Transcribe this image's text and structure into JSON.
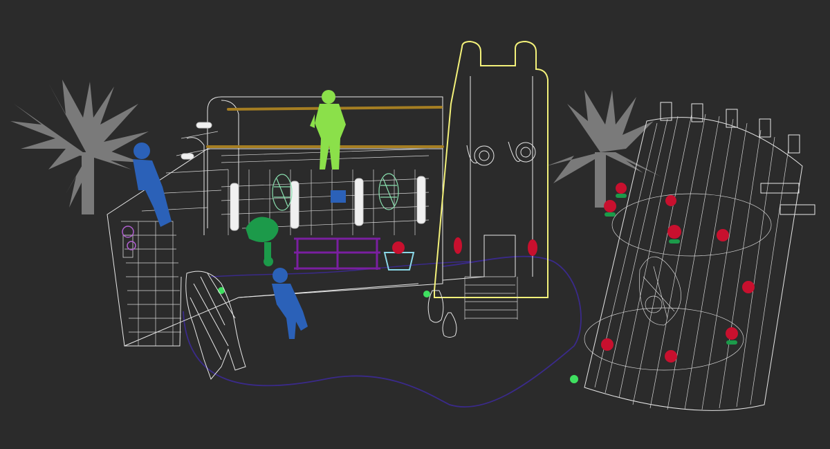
{
  "viewport": {
    "background": "#2b2b2b",
    "wireframe_color": "#e8e8e8",
    "selection_color": "#f4f27a",
    "spline_color": "#3a2a8a",
    "figure_colors": {
      "green": "#8be04a",
      "blue": "#2b61b8",
      "purple": "#7a1fa0",
      "red": "#c8102e",
      "dark_green": "#1c9a4a",
      "cyan": "#8ad8e8",
      "gold": "#a57e22"
    }
  },
  "scene_objects": [
    "palm-tree-left",
    "palm-tree-right",
    "stage-wireframe",
    "selected-slide-tower",
    "cylindrical-castle-tower",
    "figure-green-standing",
    "figure-blue-left",
    "figure-blue-center",
    "animal-wireframe",
    "spline-path"
  ]
}
